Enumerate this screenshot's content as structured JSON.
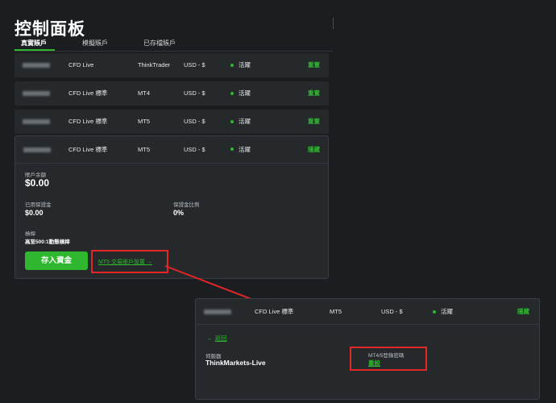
{
  "page": {
    "title": "控制面板"
  },
  "tabs": [
    {
      "label": "真實賬戶",
      "active": true
    },
    {
      "label": "模擬賬戶",
      "active": false
    },
    {
      "label": "已存檔賬戶",
      "active": false
    }
  ],
  "accounts": [
    {
      "type": "CFD Live",
      "platform": "ThinkTrader",
      "currency": "USD - $",
      "status": "活躍",
      "action": "重置"
    },
    {
      "type": "CFD Live 標準",
      "platform": "MT4",
      "currency": "USD - $",
      "status": "活躍",
      "action": "重置"
    },
    {
      "type": "CFD Live 標準",
      "platform": "MT5",
      "currency": "USD - $",
      "status": "活躍",
      "action": "重置"
    }
  ],
  "expanded": {
    "type": "CFD Live 標準",
    "platform": "MT5",
    "currency": "USD - $",
    "status": "活躍",
    "action": "隱藏",
    "balance_label": "賬戶余額",
    "balance_value": "$0.00",
    "margin_used_label": "已用保證金",
    "margin_used_value": "$0.00",
    "margin_ratio_label": "保證金比例",
    "margin_ratio_value": "0%",
    "leverage_label": "槓桿",
    "leverage_value": "高至500:1動態槓桿",
    "deposit_button": "存入資金",
    "settings_link": "MT5 交易賬戶設置",
    "settings_arrow": "→"
  },
  "detail_card": {
    "type": "CFD Live 標準",
    "platform": "MT5",
    "currency": "USD - $",
    "status": "活躍",
    "action": "隱藏",
    "back_arrow": "←",
    "back_label": "返回",
    "server_label": "伺服器",
    "server_value": "ThinkMarkets-Live",
    "password_label": "MT4/5登錄密碼",
    "password_action": "重設"
  },
  "colors": {
    "accent": "#2fb82f",
    "highlight": "#e32626",
    "background": "#1b1e21",
    "card": "#25292c"
  }
}
